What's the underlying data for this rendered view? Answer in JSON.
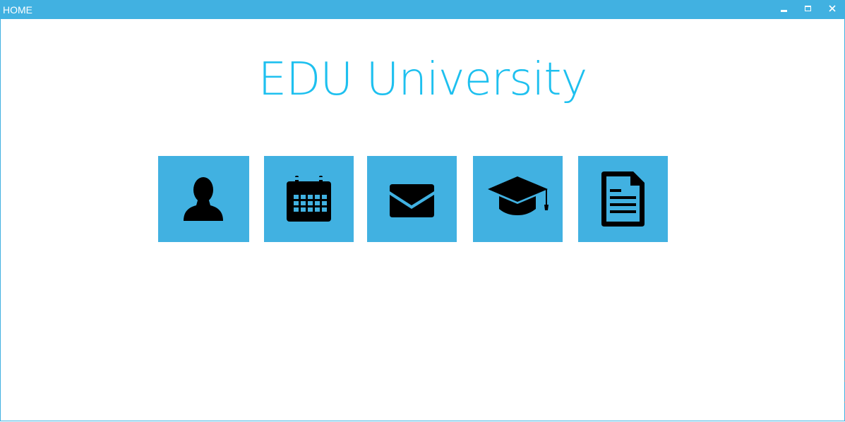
{
  "window": {
    "title": "HOME",
    "controls": {
      "minimize_icon": "minimize-icon",
      "maximize_icon": "maximize-icon",
      "close_icon": "close-icon"
    }
  },
  "main": {
    "heading": "EDU University",
    "tiles": [
      {
        "icon": "user-icon"
      },
      {
        "icon": "calendar-icon"
      },
      {
        "icon": "mail-icon"
      },
      {
        "icon": "graduation-cap-icon"
      },
      {
        "icon": "document-icon"
      }
    ]
  },
  "colors": {
    "accent": "#41b1e1",
    "heading": "#1ec0ef",
    "icon": "#000000",
    "background": "#ffffff"
  }
}
